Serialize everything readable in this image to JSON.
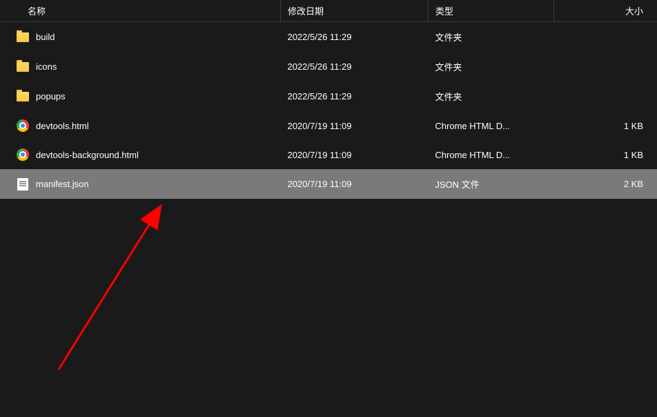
{
  "columns": {
    "name": "名称",
    "date": "修改日期",
    "type": "类型",
    "size": "大小"
  },
  "rows": [
    {
      "icon": "folder",
      "name": "build",
      "date": "2022/5/26 11:29",
      "type": "文件夹",
      "size": "",
      "selected": false
    },
    {
      "icon": "folder",
      "name": "icons",
      "date": "2022/5/26 11:29",
      "type": "文件夹",
      "size": "",
      "selected": false
    },
    {
      "icon": "folder",
      "name": "popups",
      "date": "2022/5/26 11:29",
      "type": "文件夹",
      "size": "",
      "selected": false
    },
    {
      "icon": "chrome",
      "name": "devtools.html",
      "date": "2020/7/19 11:09",
      "type": "Chrome HTML D...",
      "size": "1 KB",
      "selected": false
    },
    {
      "icon": "chrome",
      "name": "devtools-background.html",
      "date": "2020/7/19 11:09",
      "type": "Chrome HTML D...",
      "size": "1 KB",
      "selected": false
    },
    {
      "icon": "doc",
      "name": "manifest.json",
      "date": "2020/7/19 11:09",
      "type": "JSON 文件",
      "size": "2 KB",
      "selected": true
    }
  ]
}
